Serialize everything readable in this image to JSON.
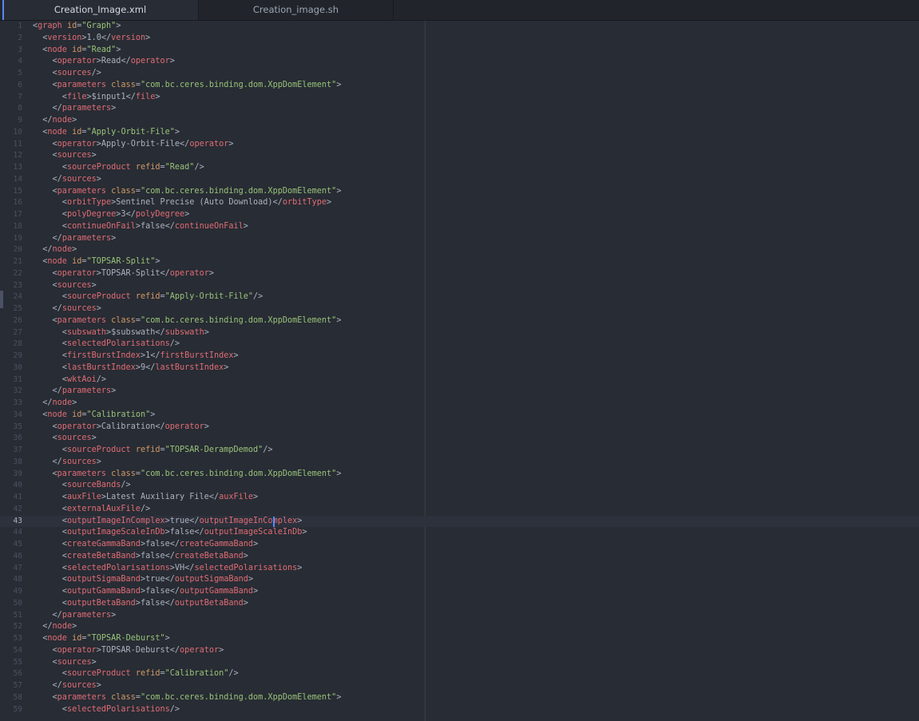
{
  "tabs": [
    {
      "label": "Creation_Image.xml",
      "active": true
    },
    {
      "label": "Creation_image.sh",
      "active": false
    }
  ],
  "editor": {
    "current_line": 43,
    "lines": [
      [
        [
          "p",
          "<"
        ],
        [
          "t",
          "graph"
        ],
        [
          "p",
          " "
        ],
        [
          "a",
          "id"
        ],
        [
          "p",
          "="
        ],
        [
          "s",
          "\"Graph\""
        ],
        [
          "p",
          ">"
        ]
      ],
      [
        [
          "p",
          "  <"
        ],
        [
          "t",
          "version"
        ],
        [
          "p",
          ">"
        ],
        [
          "x",
          "1.0"
        ],
        [
          "p",
          "</"
        ],
        [
          "t",
          "version"
        ],
        [
          "p",
          ">"
        ]
      ],
      [
        [
          "p",
          "  <"
        ],
        [
          "t",
          "node"
        ],
        [
          "p",
          " "
        ],
        [
          "a",
          "id"
        ],
        [
          "p",
          "="
        ],
        [
          "s",
          "\"Read\""
        ],
        [
          "p",
          ">"
        ]
      ],
      [
        [
          "p",
          "    <"
        ],
        [
          "t",
          "operator"
        ],
        [
          "p",
          ">"
        ],
        [
          "x",
          "Read"
        ],
        [
          "p",
          "</"
        ],
        [
          "t",
          "operator"
        ],
        [
          "p",
          ">"
        ]
      ],
      [
        [
          "p",
          "    <"
        ],
        [
          "t",
          "sources"
        ],
        [
          "p",
          "/>"
        ]
      ],
      [
        [
          "p",
          "    <"
        ],
        [
          "t",
          "parameters"
        ],
        [
          "p",
          " "
        ],
        [
          "a",
          "class"
        ],
        [
          "p",
          "="
        ],
        [
          "s",
          "\"com.bc.ceres.binding.dom.XppDomElement\""
        ],
        [
          "p",
          ">"
        ]
      ],
      [
        [
          "p",
          "      <"
        ],
        [
          "t",
          "file"
        ],
        [
          "p",
          ">"
        ],
        [
          "x",
          "$input1"
        ],
        [
          "p",
          "</"
        ],
        [
          "t",
          "file"
        ],
        [
          "p",
          ">"
        ]
      ],
      [
        [
          "p",
          "    </"
        ],
        [
          "t",
          "parameters"
        ],
        [
          "p",
          ">"
        ]
      ],
      [
        [
          "p",
          "  </"
        ],
        [
          "t",
          "node"
        ],
        [
          "p",
          ">"
        ]
      ],
      [
        [
          "p",
          "  <"
        ],
        [
          "t",
          "node"
        ],
        [
          "p",
          " "
        ],
        [
          "a",
          "id"
        ],
        [
          "p",
          "="
        ],
        [
          "s",
          "\"Apply-Orbit-File\""
        ],
        [
          "p",
          ">"
        ]
      ],
      [
        [
          "p",
          "    <"
        ],
        [
          "t",
          "operator"
        ],
        [
          "p",
          ">"
        ],
        [
          "x",
          "Apply-Orbit-File"
        ],
        [
          "p",
          "</"
        ],
        [
          "t",
          "operator"
        ],
        [
          "p",
          ">"
        ]
      ],
      [
        [
          "p",
          "    <"
        ],
        [
          "t",
          "sources"
        ],
        [
          "p",
          ">"
        ]
      ],
      [
        [
          "p",
          "      <"
        ],
        [
          "t",
          "sourceProduct"
        ],
        [
          "p",
          " "
        ],
        [
          "a",
          "refid"
        ],
        [
          "p",
          "="
        ],
        [
          "s",
          "\"Read\""
        ],
        [
          "p",
          "/>"
        ]
      ],
      [
        [
          "p",
          "    </"
        ],
        [
          "t",
          "sources"
        ],
        [
          "p",
          ">"
        ]
      ],
      [
        [
          "p",
          "    <"
        ],
        [
          "t",
          "parameters"
        ],
        [
          "p",
          " "
        ],
        [
          "a",
          "class"
        ],
        [
          "p",
          "="
        ],
        [
          "s",
          "\"com.bc.ceres.binding.dom.XppDomElement\""
        ],
        [
          "p",
          ">"
        ]
      ],
      [
        [
          "p",
          "      <"
        ],
        [
          "t",
          "orbitType"
        ],
        [
          "p",
          ">"
        ],
        [
          "x",
          "Sentinel Precise (Auto Download)"
        ],
        [
          "p",
          "</"
        ],
        [
          "t",
          "orbitType"
        ],
        [
          "p",
          ">"
        ]
      ],
      [
        [
          "p",
          "      <"
        ],
        [
          "t",
          "polyDegree"
        ],
        [
          "p",
          ">"
        ],
        [
          "x",
          "3"
        ],
        [
          "p",
          "</"
        ],
        [
          "t",
          "polyDegree"
        ],
        [
          "p",
          ">"
        ]
      ],
      [
        [
          "p",
          "      <"
        ],
        [
          "t",
          "continueOnFail"
        ],
        [
          "p",
          ">"
        ],
        [
          "x",
          "false"
        ],
        [
          "p",
          "</"
        ],
        [
          "t",
          "continueOnFail"
        ],
        [
          "p",
          ">"
        ]
      ],
      [
        [
          "p",
          "    </"
        ],
        [
          "t",
          "parameters"
        ],
        [
          "p",
          ">"
        ]
      ],
      [
        [
          "p",
          "  </"
        ],
        [
          "t",
          "node"
        ],
        [
          "p",
          ">"
        ]
      ],
      [
        [
          "p",
          "  <"
        ],
        [
          "t",
          "node"
        ],
        [
          "p",
          " "
        ],
        [
          "a",
          "id"
        ],
        [
          "p",
          "="
        ],
        [
          "s",
          "\"TOPSAR-Split\""
        ],
        [
          "p",
          ">"
        ]
      ],
      [
        [
          "p",
          "    <"
        ],
        [
          "t",
          "operator"
        ],
        [
          "p",
          ">"
        ],
        [
          "x",
          "TOPSAR-Split"
        ],
        [
          "p",
          "</"
        ],
        [
          "t",
          "operator"
        ],
        [
          "p",
          ">"
        ]
      ],
      [
        [
          "p",
          "    <"
        ],
        [
          "t",
          "sources"
        ],
        [
          "p",
          ">"
        ]
      ],
      [
        [
          "p",
          "      <"
        ],
        [
          "t",
          "sourceProduct"
        ],
        [
          "p",
          " "
        ],
        [
          "a",
          "refid"
        ],
        [
          "p",
          "="
        ],
        [
          "s",
          "\"Apply-Orbit-File\""
        ],
        [
          "p",
          "/>"
        ]
      ],
      [
        [
          "p",
          "    </"
        ],
        [
          "t",
          "sources"
        ],
        [
          "p",
          ">"
        ]
      ],
      [
        [
          "p",
          "    <"
        ],
        [
          "t",
          "parameters"
        ],
        [
          "p",
          " "
        ],
        [
          "a",
          "class"
        ],
        [
          "p",
          "="
        ],
        [
          "s",
          "\"com.bc.ceres.binding.dom.XppDomElement\""
        ],
        [
          "p",
          ">"
        ]
      ],
      [
        [
          "p",
          "      <"
        ],
        [
          "t",
          "subswath"
        ],
        [
          "p",
          ">"
        ],
        [
          "x",
          "$subswath"
        ],
        [
          "p",
          "</"
        ],
        [
          "t",
          "subswath"
        ],
        [
          "p",
          ">"
        ]
      ],
      [
        [
          "p",
          "      <"
        ],
        [
          "t",
          "selectedPolarisations"
        ],
        [
          "p",
          "/>"
        ]
      ],
      [
        [
          "p",
          "      <"
        ],
        [
          "t",
          "firstBurstIndex"
        ],
        [
          "p",
          ">"
        ],
        [
          "x",
          "1"
        ],
        [
          "p",
          "</"
        ],
        [
          "t",
          "firstBurstIndex"
        ],
        [
          "p",
          ">"
        ]
      ],
      [
        [
          "p",
          "      <"
        ],
        [
          "t",
          "lastBurstIndex"
        ],
        [
          "p",
          ">"
        ],
        [
          "x",
          "9"
        ],
        [
          "p",
          "</"
        ],
        [
          "t",
          "lastBurstIndex"
        ],
        [
          "p",
          ">"
        ]
      ],
      [
        [
          "p",
          "      <"
        ],
        [
          "t",
          "wktAoi"
        ],
        [
          "p",
          "/>"
        ]
      ],
      [
        [
          "p",
          "    </"
        ],
        [
          "t",
          "parameters"
        ],
        [
          "p",
          ">"
        ]
      ],
      [
        [
          "p",
          "  </"
        ],
        [
          "t",
          "node"
        ],
        [
          "p",
          ">"
        ]
      ],
      [
        [
          "p",
          "  <"
        ],
        [
          "t",
          "node"
        ],
        [
          "p",
          " "
        ],
        [
          "a",
          "id"
        ],
        [
          "p",
          "="
        ],
        [
          "s",
          "\"Calibration\""
        ],
        [
          "p",
          ">"
        ]
      ],
      [
        [
          "p",
          "    <"
        ],
        [
          "t",
          "operator"
        ],
        [
          "p",
          ">"
        ],
        [
          "x",
          "Calibration"
        ],
        [
          "p",
          "</"
        ],
        [
          "t",
          "operator"
        ],
        [
          "p",
          ">"
        ]
      ],
      [
        [
          "p",
          "    <"
        ],
        [
          "t",
          "sources"
        ],
        [
          "p",
          ">"
        ]
      ],
      [
        [
          "p",
          "      <"
        ],
        [
          "t",
          "sourceProduct"
        ],
        [
          "p",
          " "
        ],
        [
          "a",
          "refid"
        ],
        [
          "p",
          "="
        ],
        [
          "s",
          "\"TOPSAR-DerampDemod\""
        ],
        [
          "p",
          "/>"
        ]
      ],
      [
        [
          "p",
          "    </"
        ],
        [
          "t",
          "sources"
        ],
        [
          "p",
          ">"
        ]
      ],
      [
        [
          "p",
          "    <"
        ],
        [
          "t",
          "parameters"
        ],
        [
          "p",
          " "
        ],
        [
          "a",
          "class"
        ],
        [
          "p",
          "="
        ],
        [
          "s",
          "\"com.bc.ceres.binding.dom.XppDomElement\""
        ],
        [
          "p",
          ">"
        ]
      ],
      [
        [
          "p",
          "      <"
        ],
        [
          "t",
          "sourceBands"
        ],
        [
          "p",
          "/>"
        ]
      ],
      [
        [
          "p",
          "      <"
        ],
        [
          "t",
          "auxFile"
        ],
        [
          "p",
          ">"
        ],
        [
          "x",
          "Latest Auxiliary File"
        ],
        [
          "p",
          "</"
        ],
        [
          "t",
          "auxFile"
        ],
        [
          "p",
          ">"
        ]
      ],
      [
        [
          "p",
          "      <"
        ],
        [
          "t",
          "externalAuxFile"
        ],
        [
          "p",
          "/>"
        ]
      ],
      [
        [
          "p",
          "      <"
        ],
        [
          "t",
          "outputImageInComplex"
        ],
        [
          "p",
          ">"
        ],
        [
          "x",
          "true"
        ],
        [
          "p",
          "</"
        ],
        [
          "t",
          "outputImageInComplex"
        ],
        [
          "p",
          ">"
        ]
      ],
      [
        [
          "p",
          "      <"
        ],
        [
          "t",
          "outputImageScaleInDb"
        ],
        [
          "p",
          ">"
        ],
        [
          "x",
          "false"
        ],
        [
          "p",
          "</"
        ],
        [
          "t",
          "outputImageScaleInDb"
        ],
        [
          "p",
          ">"
        ]
      ],
      [
        [
          "p",
          "      <"
        ],
        [
          "t",
          "createGammaBand"
        ],
        [
          "p",
          ">"
        ],
        [
          "x",
          "false"
        ],
        [
          "p",
          "</"
        ],
        [
          "t",
          "createGammaBand"
        ],
        [
          "p",
          ">"
        ]
      ],
      [
        [
          "p",
          "      <"
        ],
        [
          "t",
          "createBetaBand"
        ],
        [
          "p",
          ">"
        ],
        [
          "x",
          "false"
        ],
        [
          "p",
          "</"
        ],
        [
          "t",
          "createBetaBand"
        ],
        [
          "p",
          ">"
        ]
      ],
      [
        [
          "p",
          "      <"
        ],
        [
          "t",
          "selectedPolarisations"
        ],
        [
          "p",
          ">"
        ],
        [
          "x",
          "VH"
        ],
        [
          "p",
          "</"
        ],
        [
          "t",
          "selectedPolarisations"
        ],
        [
          "p",
          ">"
        ]
      ],
      [
        [
          "p",
          "      <"
        ],
        [
          "t",
          "outputSigmaBand"
        ],
        [
          "p",
          ">"
        ],
        [
          "x",
          "true"
        ],
        [
          "p",
          "</"
        ],
        [
          "t",
          "outputSigmaBand"
        ],
        [
          "p",
          ">"
        ]
      ],
      [
        [
          "p",
          "      <"
        ],
        [
          "t",
          "outputGammaBand"
        ],
        [
          "p",
          ">"
        ],
        [
          "x",
          "false"
        ],
        [
          "p",
          "</"
        ],
        [
          "t",
          "outputGammaBand"
        ],
        [
          "p",
          ">"
        ]
      ],
      [
        [
          "p",
          "      <"
        ],
        [
          "t",
          "outputBetaBand"
        ],
        [
          "p",
          ">"
        ],
        [
          "x",
          "false"
        ],
        [
          "p",
          "</"
        ],
        [
          "t",
          "outputBetaBand"
        ],
        [
          "p",
          ">"
        ]
      ],
      [
        [
          "p",
          "    </"
        ],
        [
          "t",
          "parameters"
        ],
        [
          "p",
          ">"
        ]
      ],
      [
        [
          "p",
          "  </"
        ],
        [
          "t",
          "node"
        ],
        [
          "p",
          ">"
        ]
      ],
      [
        [
          "p",
          "  <"
        ],
        [
          "t",
          "node"
        ],
        [
          "p",
          " "
        ],
        [
          "a",
          "id"
        ],
        [
          "p",
          "="
        ],
        [
          "s",
          "\"TOPSAR-Deburst\""
        ],
        [
          "p",
          ">"
        ]
      ],
      [
        [
          "p",
          "    <"
        ],
        [
          "t",
          "operator"
        ],
        [
          "p",
          ">"
        ],
        [
          "x",
          "TOPSAR-Deburst"
        ],
        [
          "p",
          "</"
        ],
        [
          "t",
          "operator"
        ],
        [
          "p",
          ">"
        ]
      ],
      [
        [
          "p",
          "    <"
        ],
        [
          "t",
          "sources"
        ],
        [
          "p",
          ">"
        ]
      ],
      [
        [
          "p",
          "      <"
        ],
        [
          "t",
          "sourceProduct"
        ],
        [
          "p",
          " "
        ],
        [
          "a",
          "refid"
        ],
        [
          "p",
          "="
        ],
        [
          "s",
          "\"Calibration\""
        ],
        [
          "p",
          "/>"
        ]
      ],
      [
        [
          "p",
          "    </"
        ],
        [
          "t",
          "sources"
        ],
        [
          "p",
          ">"
        ]
      ],
      [
        [
          "p",
          "    <"
        ],
        [
          "t",
          "parameters"
        ],
        [
          "p",
          " "
        ],
        [
          "a",
          "class"
        ],
        [
          "p",
          "="
        ],
        [
          "s",
          "\"com.bc.ceres.binding.dom.XppDomElement\""
        ],
        [
          "p",
          ">"
        ]
      ],
      [
        [
          "p",
          "      <"
        ],
        [
          "t",
          "selectedPolarisations"
        ],
        [
          "p",
          "/>"
        ]
      ]
    ]
  }
}
